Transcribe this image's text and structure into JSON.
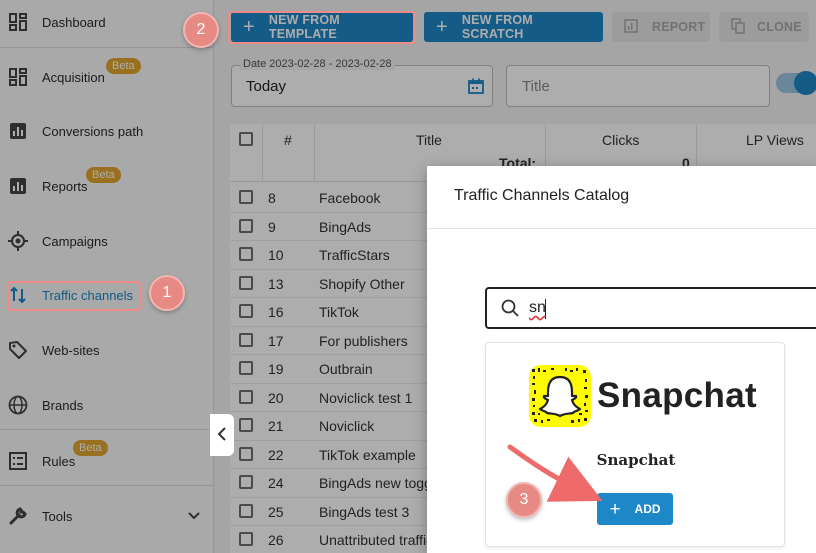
{
  "sidebar": {
    "items": [
      {
        "label": "Dashboard",
        "icon": "dashboard-icon"
      },
      {
        "label": "Acquisition",
        "icon": "dashboard-icon",
        "badge": "Beta"
      },
      {
        "label": "Conversions path",
        "icon": "bar-chart-icon"
      },
      {
        "label": "Reports",
        "icon": "bar-chart-icon",
        "badge": "Beta"
      },
      {
        "label": "Campaigns",
        "icon": "target-icon"
      },
      {
        "label": "Traffic channels",
        "icon": "swap-vertical-icon",
        "active": true
      },
      {
        "label": "Web-sites",
        "icon": "tag-icon"
      },
      {
        "label": "Brands",
        "icon": "globe-icon"
      },
      {
        "label": "Rules",
        "icon": "list-icon",
        "badge": "Beta"
      },
      {
        "label": "Tools",
        "icon": "wrench-icon"
      }
    ]
  },
  "toolbar": {
    "new_from_template": "NEW FROM TEMPLATE",
    "new_from_scratch": "NEW FROM SCRATCH",
    "report": "REPORT",
    "clone": "CLONE"
  },
  "filters": {
    "date_legend": "Date 2023-02-28 - 2023-02-28",
    "date_value": "Today",
    "title_placeholder": "Title"
  },
  "table": {
    "headers": {
      "hash": "#",
      "title": "Title",
      "clicks": "Clicks",
      "lp_views": "LP Views"
    },
    "total_label": "Total:",
    "total_clicks": "0",
    "rows": [
      {
        "id": "8",
        "title": "Facebook"
      },
      {
        "id": "9",
        "title": "BingAds"
      },
      {
        "id": "10",
        "title": "TrafficStars"
      },
      {
        "id": "13",
        "title": "Shopify Other"
      },
      {
        "id": "16",
        "title": "TikTok"
      },
      {
        "id": "17",
        "title": "For publishers"
      },
      {
        "id": "19",
        "title": "Outbrain"
      },
      {
        "id": "20",
        "title": "Noviclick test 1"
      },
      {
        "id": "21",
        "title": "Noviclick"
      },
      {
        "id": "22",
        "title": "TikTok example"
      },
      {
        "id": "24",
        "title": "BingAds new toggle"
      },
      {
        "id": "25",
        "title": "BingAds test 3"
      },
      {
        "id": "26",
        "title": "Unattributed traffic"
      }
    ]
  },
  "modal": {
    "title": "Traffic Channels Catalog",
    "search_value": "sn",
    "card": {
      "logo_text": "Snapchat",
      "name": "Snapchat",
      "add_label": "ADD"
    }
  },
  "steps": {
    "one": "1",
    "two": "2",
    "three": "3"
  },
  "colors": {
    "accent": "#1e87c8",
    "beta": "#e0a530",
    "highlight": "#ef8a88",
    "snap_yellow": "#fffc00"
  }
}
